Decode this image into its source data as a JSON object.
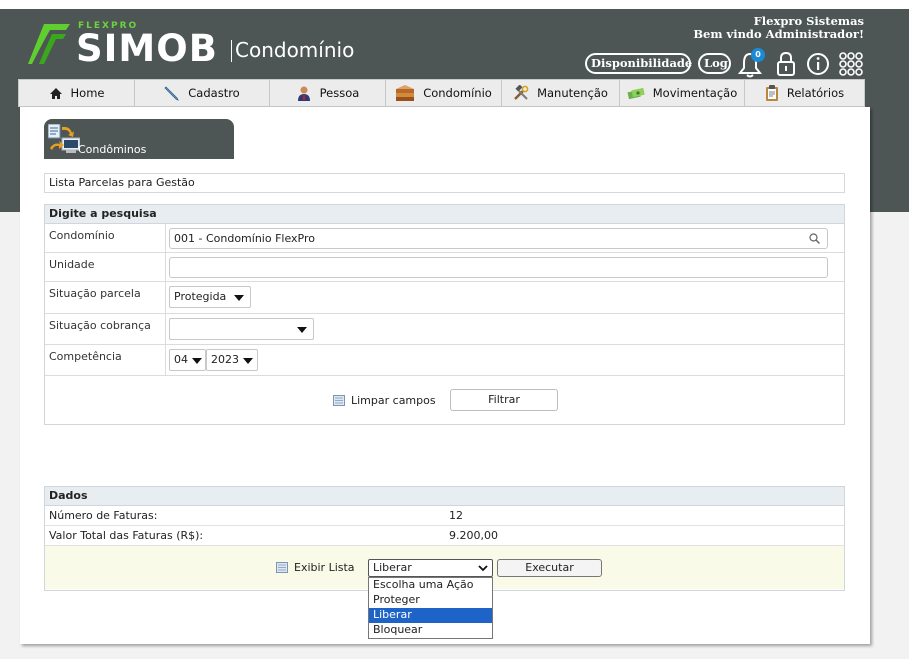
{
  "header": {
    "brand_small": "FLEXPRO",
    "brand_big": "SIMOB",
    "product": "Condomínio",
    "company": "Flexpro Sistemas",
    "welcome": "Bem vindo Administrador!",
    "actions": {
      "availability": "Disponibilidade",
      "log": "Log",
      "notifications_count": "0"
    }
  },
  "nav": {
    "items": [
      {
        "label": "Home",
        "icon": "home-icon"
      },
      {
        "label": "Cadastro",
        "icon": "pencil-icon"
      },
      {
        "label": "Pessoa",
        "icon": "person-icon"
      },
      {
        "label": "Condomínio",
        "icon": "buildings-icon"
      },
      {
        "label": "Manutenção",
        "icon": "tools-icon"
      },
      {
        "label": "Movimentação",
        "icon": "money-icon"
      },
      {
        "label": "Relatórios",
        "icon": "clipboard-icon"
      }
    ]
  },
  "tab": {
    "label": "Condôminos"
  },
  "page": {
    "title": "Lista Parcelas para Gestão"
  },
  "search": {
    "header": "Digite a pesquisa",
    "condominio_label": "Condomínio",
    "condominio_value": "001 - Condomínio FlexPro",
    "unidade_label": "Unidade",
    "unidade_value": "",
    "situacao_parcela_label": "Situação parcela",
    "situacao_parcela_value": "Protegida",
    "situacao_cobranca_label": "Situação cobrança",
    "situacao_cobranca_value": "",
    "competencia_label": "Competência",
    "competencia_month": "04",
    "competencia_year": "2023",
    "clear_label": "Limpar campos",
    "filter_label": "Filtrar"
  },
  "dados": {
    "header": "Dados",
    "rows": [
      {
        "label": "Número de Faturas:",
        "value": "12"
      },
      {
        "label": "Valor Total das Faturas (R$):",
        "value": "9.200,00"
      }
    ],
    "show_list_label": "Exibir Lista",
    "action_selected": "Liberar",
    "action_options": [
      "Escolha uma Ação",
      "Proteger",
      "Liberar",
      "Bloquear"
    ],
    "execute_label": "Executar"
  }
}
